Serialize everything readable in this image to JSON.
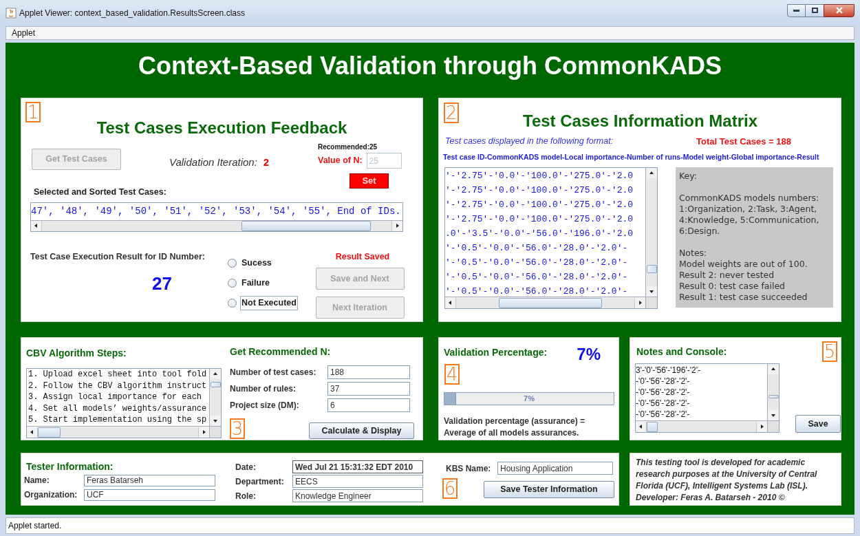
{
  "window": {
    "title": "Applet Viewer: context_based_validation.ResultsScreen.class"
  },
  "menu": [
    "Applet"
  ],
  "heading": "Context-Based Validation through CommonKADS",
  "feedback_panel": {
    "badge": "1",
    "title": "Test Cases Execution Feedback",
    "get_button": {
      "label": "Get Test Cases",
      "disabled": true
    },
    "iteration_label": "Validation Iteration:",
    "iteration_value": "2",
    "recommended": "Recommended:25",
    "n_label": "Value of N:",
    "n_field": {
      "value": "25",
      "disabled": true
    },
    "set_button": {
      "label": "Set",
      "disabled": false
    },
    "list_label": "Selected and Sorted Test Cases:",
    "list_text": "47', '48', '49', '50', '51', '52', '53', '54', '55', End of IDs.",
    "result_label": "Test Case Execution Result for ID Number:",
    "id_number": "27",
    "options": [
      {
        "label": "Sucess",
        "selected": false,
        "focused": false
      },
      {
        "label": "Failure",
        "selected": false,
        "focused": false
      },
      {
        "label": "Not Executed",
        "selected": false,
        "focused": true
      }
    ],
    "status": "Result Saved",
    "buttons": [
      {
        "label": "Save and Next",
        "disabled": true
      },
      {
        "label": "Next Iteration",
        "disabled": true
      }
    ]
  },
  "matrix_panel": {
    "badge": "2",
    "title": "Test Cases Information Matrix",
    "format_note": "Test cases displayed in the following format:",
    "total": "Total Test Cases = 188",
    "format": "Test case ID-CommonKADS model-Local importance-Number of runs-Model weight-Global importance-Result",
    "rows": [
      "'-'2.75'-'0.0'-'100.0'-'275.0'-'2.0",
      "'-'2.75'-'0.0'-'100.0'-'275.0'-'2.0",
      "'-'2.75'-'0.0'-'100.0'-'275.0'-'2.0",
      "'-'2.75'-'0.0'-'100.0'-'275.0'-'2.0",
      ".0'-'3.5'-'0.0'-'56.0'-'196.0'-'2.0",
      "'-'0.5'-'0.0'-'56.0'-'28.0'-'2.0'-",
      "'-'0.5'-'0.0'-'56.0'-'28.0'-'2.0'-",
      "'-'0.5'-'0.0'-'56.0'-'28.0'-'2.0'-",
      "'-'0.5'-'0.0'-'56.0'-'28.0'-'2.0'-"
    ],
    "key": {
      "title": "Key:",
      "models_heading": "CommonKADS models numbers:",
      "models_lines": [
        "1:Organization, 2:Task, 3:Agent,",
        "4:Knowledge, 5:Communication,",
        "6:Design."
      ],
      "notes_heading": "Notes:",
      "notes": [
        "Model weights are out of 100.",
        "Result 2: never tested",
        "Result 0: test case failed",
        "Result 1: test case succeeded"
      ]
    }
  },
  "steps_panel": {
    "title": "CBV Algorithm Steps:",
    "steps": [
      "1. Upload excel sheet into tool fold",
      "2. Follow the CBV algorithm instruct",
      "3. Assign local importance for each",
      "4. Set all models’ weights/assurance",
      "5. Start implementation using the sp"
    ]
  },
  "recommend_panel": {
    "title": "Get Recommended N:",
    "fields": [
      {
        "label": "Number of test cases:",
        "value": "188"
      },
      {
        "label": "Number of rules:",
        "value": "37"
      },
      {
        "label": "Project size (DM):",
        "value": "6"
      }
    ],
    "badge": "3",
    "button": "Calculate & Display"
  },
  "percentage_panel": {
    "title": "Validation Percentage:",
    "value": "7%",
    "badge": "4",
    "progress": {
      "level": 0.07,
      "text": "7%"
    },
    "description": [
      "Validation percentage (assurance) =",
      "Average of all models assurances."
    ]
  },
  "console_panel": {
    "title": "Notes and Console:",
    "badge": "5",
    "lines": [
      "3'-'0'-'56'-'196'-'2'-",
      "-'0'-'56'-'28'-'2'-",
      "-'0'-'56'-'28'-'2'-",
      "-'0'-'56'-'28'-'2'-",
      "-'0'-'56'-'28'-'2'-"
    ],
    "button": "Save"
  },
  "tester_panel": {
    "title": "Tester Information:",
    "fields": [
      {
        "label": "Name:",
        "value": "Feras Batarseh"
      },
      {
        "label": "Organization:",
        "value": "UCF"
      },
      {
        "label": "Date:",
        "value": "Wed Jul 21 15:31:32 EDT 2010"
      },
      {
        "label": "Department:",
        "value": "EECS"
      },
      {
        "label": "Role:",
        "value": "Knowledge Engineer"
      },
      {
        "label": "KBS Name:",
        "value": "Housing Application"
      }
    ],
    "badge": "6",
    "button": "Save Tester Information"
  },
  "about": "This testing tool is developed for academic research purposes at the University of Central Florida (UCF), Intelligent Systems Lab (ISL). Developer: Feras A. Batarseh - 2010 ©",
  "status_bar": "Applet started."
}
